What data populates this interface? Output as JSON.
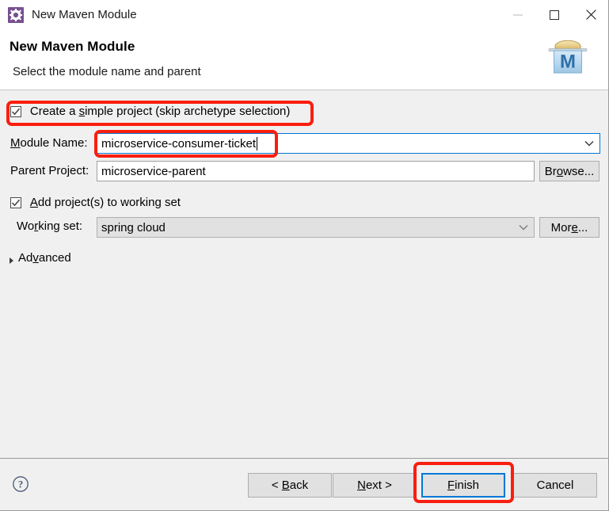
{
  "window": {
    "title": "New Maven Module",
    "icon": "maven-module-icon",
    "controls": {
      "minimize": "minimize-icon",
      "maximize": "maximize-icon",
      "close": "close-icon"
    }
  },
  "header": {
    "title": "New Maven Module",
    "subtitle": "Select the module name and parent",
    "logo": "maven-logo",
    "logo_letter": "M"
  },
  "form": {
    "simple_project": {
      "label_before": "Create a ",
      "label_mnemonic": "s",
      "label_after": "imple project (skip archetype selection)",
      "checked": true
    },
    "module_name": {
      "label_mnemonic": "M",
      "label_rest": "odule Name:",
      "value": "microservice-consumer-ticket",
      "focused": true
    },
    "parent_project": {
      "label": "Parent Project:",
      "value": "microservice-parent",
      "browse_button": {
        "before": "Br",
        "mnemonic": "o",
        "after": "wse..."
      }
    },
    "add_to_working_set": {
      "label_mnemonic": "A",
      "label_rest": "dd project(s) to working set",
      "checked": true
    },
    "working_set": {
      "label_before": "Wo",
      "label_mnemonic": "r",
      "label_after": "king set:",
      "value": "spring cloud",
      "more_button": {
        "before": "Mor",
        "mnemonic": "e",
        "after": "..."
      }
    },
    "advanced": {
      "label_before": "Ad",
      "label_mnemonic": "v",
      "label_after": "anced",
      "expanded": false
    }
  },
  "buttons": {
    "back": {
      "before": "< ",
      "mnemonic": "B",
      "after": "ack"
    },
    "next": {
      "before": "",
      "mnemonic": "N",
      "after": "ext >"
    },
    "finish": {
      "before": "",
      "mnemonic": "F",
      "after": "inish",
      "is_default": true
    },
    "cancel": {
      "before": "Cancel",
      "mnemonic": "",
      "after": ""
    },
    "help": "help-icon"
  },
  "colors": {
    "accent": "#0078d7",
    "annotation": "#fa1e0f",
    "titlebar_bg": "#ffffff",
    "body_bg": "#f0f0f0",
    "icon_purple": "#77508f"
  }
}
